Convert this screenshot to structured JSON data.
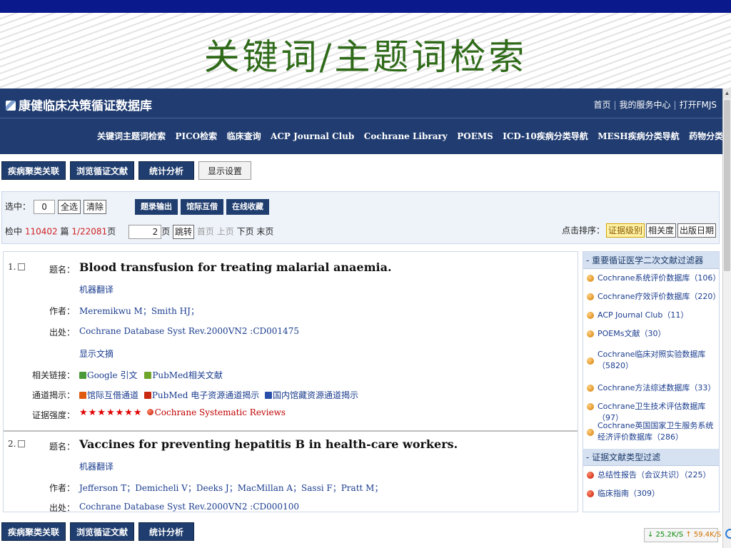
{
  "slide": {
    "title": "关键词/主题词检索"
  },
  "app": {
    "logo": "康健临床决策循证数据库",
    "toplinks": [
      "首页",
      "我的服务中心",
      "打开FMJS"
    ],
    "nav": [
      "关键词主题词检索",
      "PICO检索",
      "临床查询",
      "ACP Journal Club",
      "Cochrane Library",
      "POEMS",
      "ICD-10疾病分类导航",
      "MESH疾病分类导航",
      "药物分类导航"
    ],
    "toolbar": {
      "b1": "疾病聚类关联",
      "b2": "浏览循证文献",
      "b3": "统计分析",
      "b4": "显示设置"
    },
    "select_row": {
      "label": "选中：",
      "count": "0",
      "select_all": "全选",
      "clear": "清除",
      "export": "题录输出",
      "ill": "馆际互借",
      "fav": "在线收藏"
    },
    "pager": {
      "prefix": "检中",
      "total": "110402",
      "unit": "篇",
      "page_info": "1/22081",
      "page_suffix": "页",
      "page_input": "2",
      "page_input_suffix": "页",
      "go": "跳转",
      "first": "首页",
      "prev": "上页",
      "next": "下页",
      "last": "末页"
    },
    "sort": {
      "label": "点击排序：",
      "options": [
        "证据级别",
        "相关度",
        "出版日期"
      ]
    },
    "labels": {
      "title": "题名：",
      "authors": "作者：",
      "source": "出处：",
      "related": "相关链接：",
      "channel": "通道揭示：",
      "evidence": "证据强度："
    },
    "records": [
      {
        "num": "1.",
        "title": "Blood transfusion for treating malarial anaemia.",
        "translate": "机器翻译",
        "authors": "Meremikwu M；Smith HJ；",
        "source": "Cochrane Database Syst Rev.2000VN2 :CD001475",
        "abstract": "显示文摘",
        "related": {
          "google": "Google 引文",
          "pubmed": "PubMed相关文献"
        },
        "channel": {
          "ill": "馆际互借通道",
          "pubmed": "PubMed 电子资源通道揭示",
          "domestic": "国内馆藏资源通道揭示"
        },
        "stars": "★★★★★★★",
        "evidence_source": "Cochrane Systematic Reviews"
      },
      {
        "num": "2.",
        "title": "Vaccines for preventing hepatitis B in health-care workers.",
        "translate": "机器翻译",
        "authors": "Jefferson T；Demicheli V；Deeks J；MacMillan A；Sassi F；Pratt M；",
        "source": "Cochrane Database Syst Rev.2000VN2 :CD000100"
      }
    ],
    "filters": {
      "head1": "重要循证医学二次文献过滤器",
      "group1": [
        {
          "text": "Cochrane系统评价数据库（106）"
        },
        {
          "text": "Cochrane疗效评价数据库（220）"
        },
        {
          "text": "ACP Journal Club（11）"
        },
        {
          "text": "POEMs文献（30）"
        },
        {
          "text": "Cochrane临床对照实验数据库（5820）"
        },
        {
          "text": "Cochrane方法综述数据库（33）"
        },
        {
          "text": "Cochrane卫生技术评估数据库（97）"
        },
        {
          "text": "Cochrane英国国家卫生服务系统经济评价数据库（286）"
        }
      ],
      "head2": "证据文献类型过滤",
      "group2": [
        {
          "text": "总结性报告（会议共识）（225）"
        },
        {
          "text": "临床指南（309）"
        }
      ]
    },
    "bottom_toolbar": {
      "b1": "疾病聚类关联",
      "b2": "浏览循证文献",
      "b3": "统计分析"
    },
    "netmeter": {
      "down": "↓ 25.2K/S",
      "up": "↑ 59.4K/S"
    },
    "colors": {
      "header": "#203c70",
      "slide_bar": "#0a1a8c",
      "title_green": "#2f6a19",
      "link": "#1a3c8e"
    }
  }
}
